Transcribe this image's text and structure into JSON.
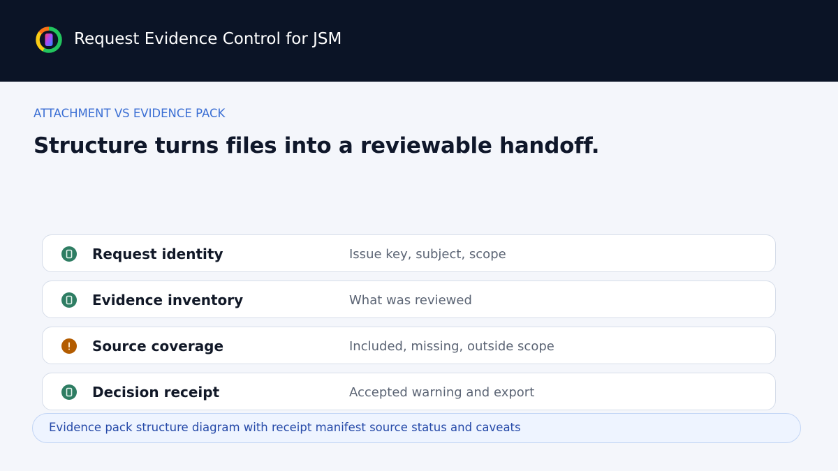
{
  "header": {
    "app_title": "Request Evidence Control for JSM",
    "logo_icon": "ring-logo-icon"
  },
  "section": {
    "eyebrow": "ATTACHMENT VS EVIDENCE PACK",
    "headline": "Structure turns files into a reviewable handoff."
  },
  "rows": [
    {
      "label": "Request identity",
      "description": "Issue key, subject, scope",
      "status": "ok",
      "status_icon": "check-badge-icon"
    },
    {
      "label": "Evidence inventory",
      "description": "What was reviewed",
      "status": "ok",
      "status_icon": "check-badge-icon"
    },
    {
      "label": "Source coverage",
      "description": "Included, missing, outside scope",
      "status": "warning",
      "status_icon": "warning-badge-icon"
    },
    {
      "label": "Decision receipt",
      "description": "Accepted warning and export",
      "status": "ok",
      "status_icon": "check-badge-icon"
    }
  ],
  "caption": "Evidence pack structure diagram with receipt manifest source status and caveats",
  "colors": {
    "header_bg": "#0b1426",
    "page_bg": "#f4f6fb",
    "accent": "#3b6fd4",
    "ok": "#2e7d63",
    "warning": "#b35c00",
    "caption_text": "#2549a8"
  }
}
